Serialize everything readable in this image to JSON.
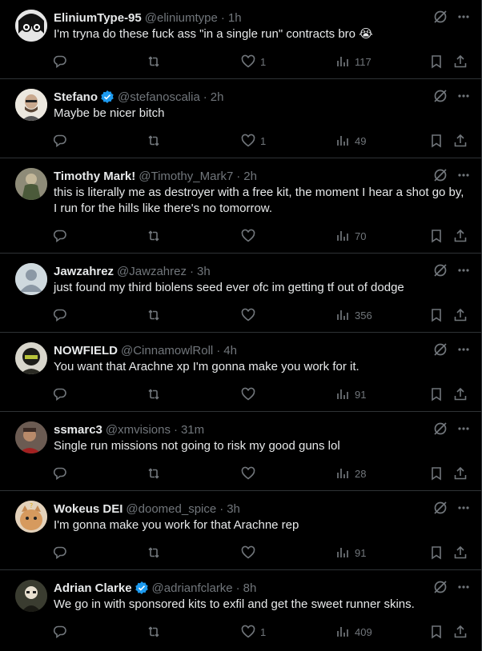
{
  "tweets": [
    {
      "name": "EliniumType-95",
      "handle": "@eliniumtype",
      "time": "1h",
      "verified": false,
      "text": "I'm tryna do these fuck ass \"in a single run\" contracts bro 😭",
      "likes": "1",
      "views": "117",
      "avatar_color": "#d9d9d9"
    },
    {
      "name": "Stefano",
      "handle": "@stefanoscalia",
      "time": "2h",
      "verified": true,
      "text": "Maybe be nicer bitch",
      "likes": "1",
      "views": "49",
      "avatar_color": "#e8e4dc"
    },
    {
      "name": "Timothy Mark!",
      "handle": "@Timothy_Mark7",
      "time": "2h",
      "verified": false,
      "text": "this is literally me as destroyer with a free kit, the moment I hear a shot go by, I run for the hills like there's no tomorrow.",
      "likes": "",
      "views": "70",
      "avatar_color": "#7b7a6a"
    },
    {
      "name": "Jawzahrez",
      "handle": "@Jawzahrez",
      "time": "3h",
      "verified": false,
      "text": "just found my third biolens seed ever ofc im getting tf out of dodge",
      "likes": "",
      "views": "356",
      "avatar_color": "#cfd9de"
    },
    {
      "name": "NOWFIELD",
      "handle": "@CinnamowlRoll",
      "time": "4h",
      "verified": false,
      "text": "You want that Arachne xp I'm gonna make you work for it.",
      "likes": "",
      "views": "91",
      "avatar_color": "#3a3a2e"
    },
    {
      "name": "ssmarc3",
      "handle": "@xmvisions",
      "time": "31m",
      "verified": false,
      "text": "Single run missions not going to risk my good guns lol",
      "likes": "",
      "views": "28",
      "avatar_color": "#5a4a44"
    },
    {
      "name": "Wokeus DEI",
      "handle": "@doomed_spice",
      "time": "3h",
      "verified": false,
      "text": "I'm gonna make you work for that Arachne rep",
      "likes": "",
      "views": "91",
      "avatar_color": "#c9a27a"
    },
    {
      "name": "Adrian Clarke",
      "handle": "@adrianfclarke",
      "time": "8h",
      "verified": true,
      "text": "We go in with sponsored kits to exfil and get the sweet runner skins.",
      "likes": "1",
      "views": "409",
      "avatar_color": "#2a2a22"
    }
  ],
  "colors": {
    "background": "#000000",
    "text": "#e7e9ea",
    "muted": "#71767b",
    "divider": "#2f3336",
    "verified": "#1d9bf0"
  },
  "icons": [
    "reply-icon",
    "repost-icon",
    "like-icon",
    "views-icon",
    "bookmark-icon",
    "share-icon",
    "grok-icon",
    "more-icon",
    "verified-badge-icon"
  ]
}
